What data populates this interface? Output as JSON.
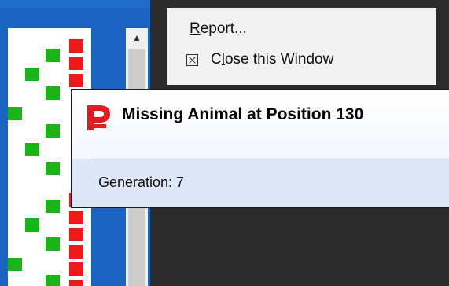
{
  "menu": {
    "items": [
      {
        "label": "Report...",
        "accel": "R"
      },
      {
        "label": "Close this Window",
        "accel": "l"
      }
    ]
  },
  "alert": {
    "title": "Missing Animal at Position 130",
    "message": "Generation: 7"
  },
  "pedigree": {
    "colors": {
      "male": "#18b418",
      "female": "#ee1a1a"
    }
  },
  "scrollbar": {
    "up_arrow": "▲"
  }
}
